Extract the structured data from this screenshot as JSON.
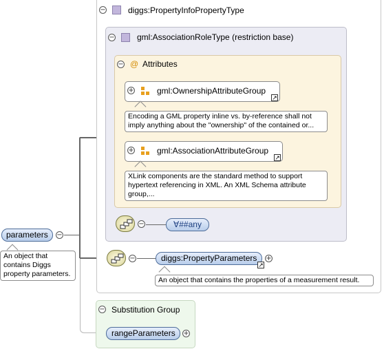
{
  "complex_type": {
    "name": "diggs:PropertyInfoPropertyType"
  },
  "restriction": {
    "name": "gml:AssociationRoleType",
    "suffix": "(restriction base)"
  },
  "attributes": {
    "label": "Attributes",
    "at_symbol": "@"
  },
  "attribute_groups": [
    {
      "name": "gml:OwnershipAttributeGroup",
      "doc": "Encoding a GML property inline vs. by-reference shall not imply anything about the \"ownership\" of the contained or..."
    },
    {
      "name": "gml:AssociationAttributeGroup",
      "doc": "XLink components are the standard method to support hypertext referencing in XML. An XML Schema attribute group,..."
    }
  ],
  "any_element": {
    "label": "##any",
    "prefix_symbol": "∀"
  },
  "root_element": {
    "name": "parameters",
    "doc": "An object that contains Diggs property parameters."
  },
  "child_element": {
    "name": "diggs:PropertyParameters",
    "doc": "An object that contains the properties of a measurement result."
  },
  "substitution_group": {
    "label": "Substitution Group",
    "members": [
      "rangeParameters"
    ]
  },
  "symbols": {
    "collapse": "−",
    "expand": "+",
    "external_link": "↗"
  },
  "colors": {
    "element_fill": "#b8cdeb",
    "attribute_fill": "#fcf4df",
    "restriction_fill": "#ececf4",
    "substitution_fill": "#eef8ec",
    "type_icon": "#c2b6dc",
    "group_icon": "#e8a01e"
  }
}
